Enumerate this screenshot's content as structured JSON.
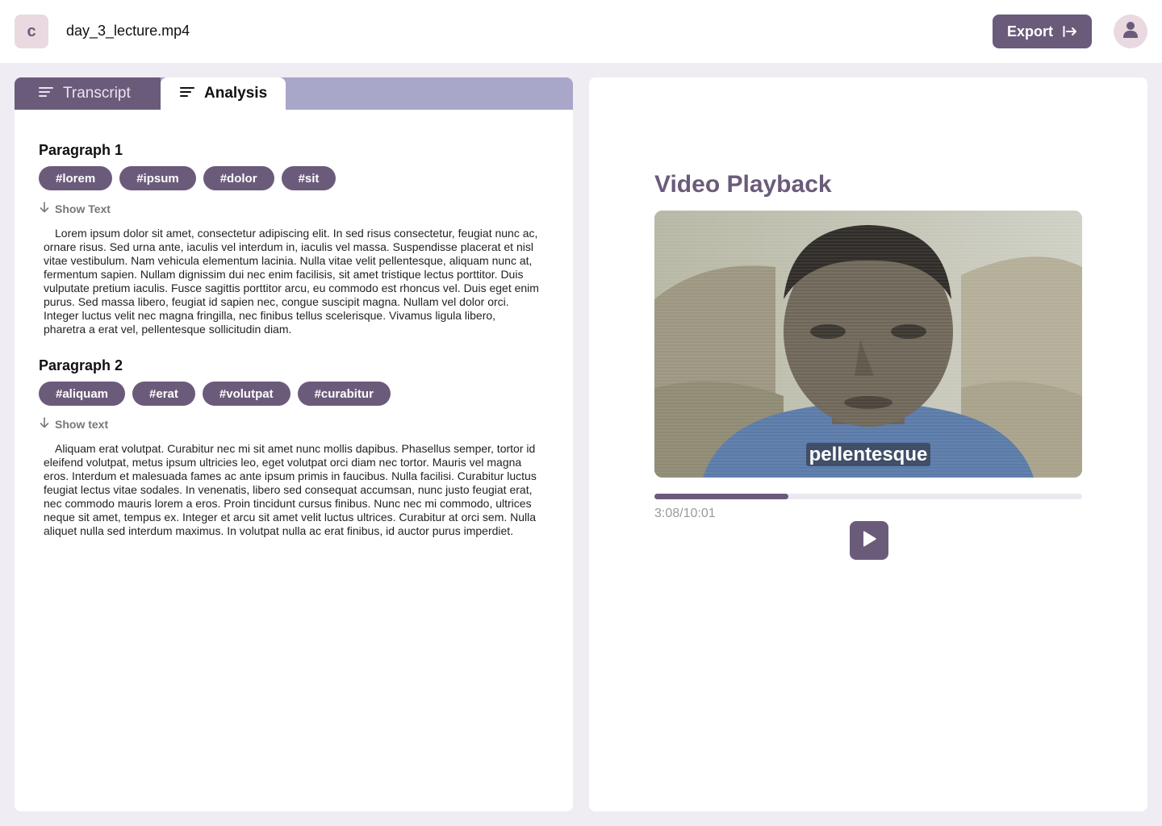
{
  "header": {
    "logo_letter": "c",
    "filename": "day_3_lecture.mp4",
    "export_label": "Export"
  },
  "tabs": [
    {
      "label": "Transcript",
      "active": false
    },
    {
      "label": "Analysis",
      "active": true
    }
  ],
  "paragraphs": [
    {
      "title": "Paragraph 1",
      "tags": [
        "#lorem",
        "#ipsum",
        "#dolor",
        "#sit"
      ],
      "toggle_label": "Show Text",
      "text": "Lorem ipsum dolor sit amet, consectetur adipiscing elit. In sed risus consectetur, feugiat nunc ac, ornare risus. Sed urna ante, iaculis vel interdum in, iaculis vel massa. Suspendisse placerat et nisl vitae vestibulum. Nam vehicula elementum lacinia. Nulla vitae velit pellentesque, aliquam nunc at, fermentum sapien. Nullam dignissim dui nec enim facilisis, sit amet tristique lectus porttitor. Duis vulputate pretium iaculis. Fusce sagittis porttitor arcu, eu commodo est rhoncus vel. Duis eget enim purus. Sed massa libero, feugiat id sapien nec, congue suscipit magna. Nullam vel dolor orci. Integer luctus velit nec magna fringilla, nec finibus tellus scelerisque. Vivamus ligula libero, pharetra a erat vel, pellentesque sollicitudin diam."
    },
    {
      "title": "Paragraph 2",
      "tags": [
        "#aliquam",
        "#erat",
        "#volutpat",
        "#curabitur"
      ],
      "toggle_label": "Show text",
      "text": "Aliquam erat volutpat. Curabitur nec mi sit amet nunc mollis dapibus. Phasellus semper, tortor id eleifend volutpat, metus ipsum ultricies leo, eget volutpat orci diam nec tortor. Mauris vel magna eros. Interdum et malesuada fames ac ante ipsum primis in faucibus. Nulla facilisi. Curabitur luctus feugiat lectus vitae sodales. In venenatis, libero sed consequat accumsan, nunc justo feugiat erat, nec commodo mauris lorem a eros. Proin tincidunt cursus finibus. Nunc nec mi commodo, ultrices neque sit amet, tempus ex. Integer et arcu sit amet velit luctus ultrices. Curabitur at orci sem. Nulla aliquet nulla sed interdum maximus. In volutpat nulla ac erat finibus, id auctor purus imperdiet."
    }
  ],
  "video": {
    "title": "Video Playback",
    "caption": "pellentesque",
    "time": "3:08/10:01",
    "progress_fraction": 0.313
  },
  "colors": {
    "accent": "#6b5b7b",
    "tabbar": "#a8a6c9",
    "background": "#efecf3",
    "logo_bg": "#ead9e1"
  },
  "icons": {
    "export": "arrow-right-to-bar-icon",
    "avatar": "user-icon",
    "tab": "lines-icon",
    "show_text": "arrow-down-icon",
    "play": "play-icon"
  }
}
